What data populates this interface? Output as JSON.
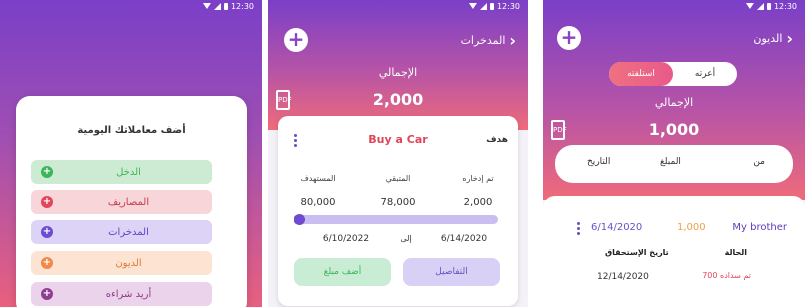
{
  "status": {
    "time": "12:30"
  },
  "panel1": {
    "title": "أضف معاملاتك اليومية",
    "rows": [
      {
        "label": "الدخل",
        "bg": "#cdebd2",
        "fg": "#3cb55a",
        "icon_bg": "#3cb55a"
      },
      {
        "label": "المصاريف",
        "bg": "#f7d5d8",
        "fg": "#c23b4a",
        "icon_bg": "#e0455a"
      },
      {
        "label": "المدخرات",
        "bg": "#dcd3f7",
        "fg": "#5f44c8",
        "icon_bg": "#6b4cd0"
      },
      {
        "label": "الديون",
        "bg": "#fde3d2",
        "fg": "#e07a3a",
        "icon_bg": "#f0894a"
      },
      {
        "label": "أريد شراءه",
        "bg": "#ecd3ec",
        "fg": "#8a3a8a",
        "icon_bg": "#8e3d92"
      }
    ],
    "icon": "plus-icon"
  },
  "panel2": {
    "header_title": "المدخرات",
    "total_label": "الإجمالي",
    "total_value": "2,000",
    "goal_label": "هدف",
    "goal_name": "Buy a Car",
    "col_saved_label": "تم إدخاره",
    "col_remaining_label": "المتبقي",
    "col_target_label": "المستهدف",
    "saved_value": "2,000",
    "remaining_value": "78,000",
    "target_value": "80,000",
    "progress": 0.025,
    "start_date": "6/14/2020",
    "to_label": "إلى",
    "end_date": "6/10/2022",
    "details_button": "التفاصيل",
    "add_amount_button": "أضف مبلغ",
    "accent_color": "#e0455a"
  },
  "panel3": {
    "header_title": "الديون",
    "tab_lent": "أعرته",
    "tab_borrowed": "استلفته",
    "total_label": "الإجمالي",
    "total_value": "1,000",
    "filter_from": "من",
    "filter_amount": "المبلغ",
    "filter_date": "التاريخ",
    "entry": {
      "name": "My brother",
      "amount": "1,000",
      "date": "6/14/2020",
      "status_label": "الحالة",
      "status_value": "تم سداده 700",
      "due_label": "تاريخ الإستحقاق",
      "due_value": "12/14/2020"
    },
    "amount_color": "#f0a04a",
    "status_color": "#e0455a"
  }
}
